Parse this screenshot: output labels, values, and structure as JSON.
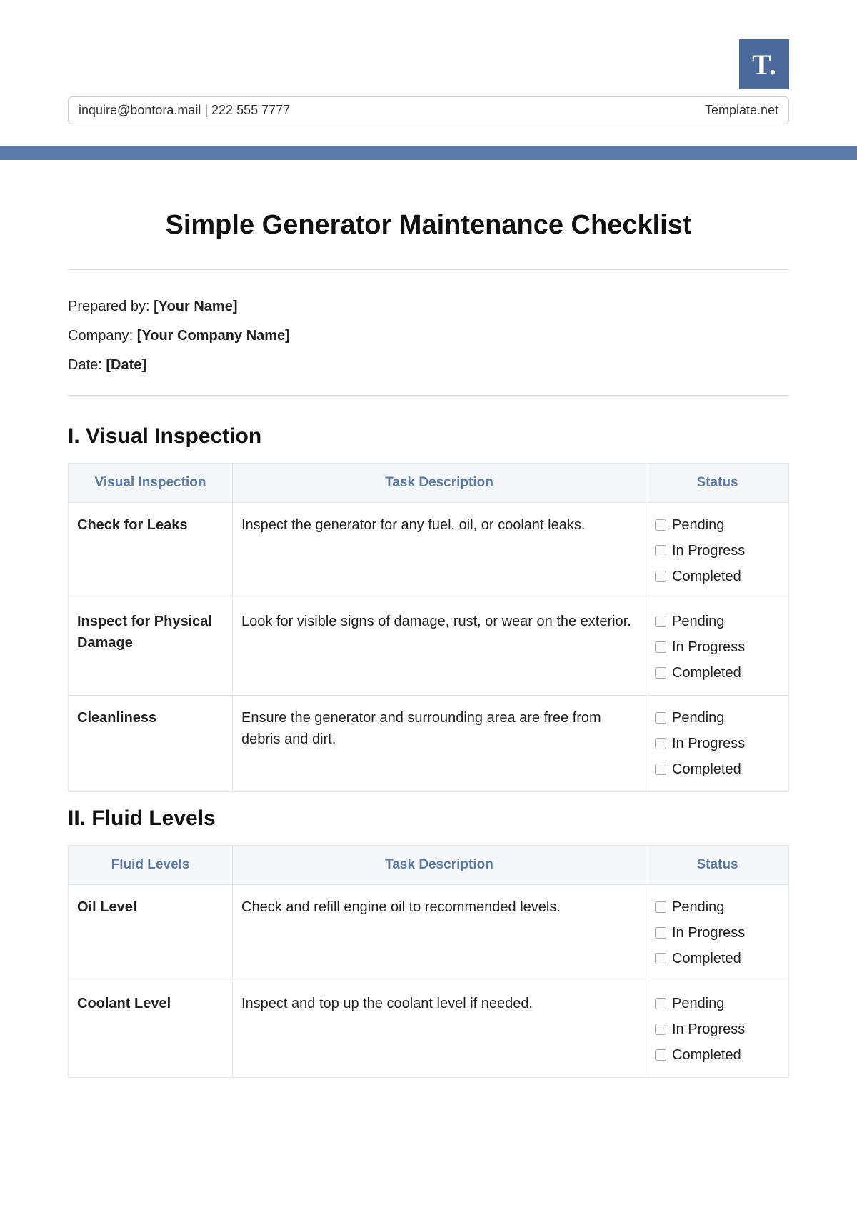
{
  "logo_text": "T.",
  "contact": "inquire@bontora.mail  |  222 555 7777",
  "brand": "Template.net",
  "title": "Simple Generator Maintenance Checklist",
  "meta": {
    "prepared_label": "Prepared by: ",
    "prepared_value": "[Your Name]",
    "company_label": "Company: ",
    "company_value": "[Your Company Name]",
    "date_label": "Date: ",
    "date_value": "[Date]"
  },
  "headers": {
    "col_task": "Task Description",
    "col_status": "Status"
  },
  "status_options": [
    "Pending",
    "In Progress",
    "Completed"
  ],
  "sections": [
    {
      "heading": "I. Visual Inspection",
      "col_item": "Visual Inspection",
      "rows": [
        {
          "item": "Check for Leaks",
          "desc": "Inspect the generator for any fuel, oil, or coolant leaks."
        },
        {
          "item": "Inspect for Physical Damage",
          "desc": "Look for visible signs of damage, rust, or wear on the exterior."
        },
        {
          "item": "Cleanliness",
          "desc": "Ensure the generator and surrounding area are free from debris and dirt."
        }
      ]
    },
    {
      "heading": "II. Fluid Levels",
      "col_item": "Fluid Levels",
      "rows": [
        {
          "item": "Oil Level",
          "desc": "Check and refill engine oil to recommended levels."
        },
        {
          "item": "Coolant Level",
          "desc": "Inspect and top up the coolant level if needed."
        }
      ]
    }
  ]
}
